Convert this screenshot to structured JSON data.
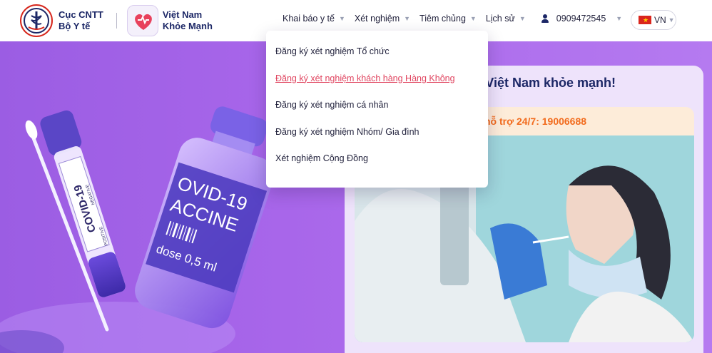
{
  "brand": {
    "moh_line1": "Cục CNTT",
    "moh_line2": "Bộ Y tế",
    "app_line1": "Việt Nam",
    "app_line2": "Khỏe Mạnh"
  },
  "nav": {
    "items": [
      {
        "label": "Khai báo y tế",
        "icon": "chevron-down-icon"
      },
      {
        "label": "Xét nghiệm",
        "icon": "chevron-down-icon"
      },
      {
        "label": "Tiêm chủng",
        "icon": "chevron-down-icon"
      },
      {
        "label": "Lịch sử",
        "icon": "chevron-down-icon"
      }
    ],
    "phone": "0909472545",
    "language": "VN"
  },
  "dropdown": {
    "items": [
      {
        "label": "Đăng ký xét nghiệm Tổ chức",
        "active": false
      },
      {
        "label": "Đăng ký xét nghiệm khách hàng Hàng Không",
        "active": true
      },
      {
        "label": "Đăng ký xét nghiệm cá nhân",
        "active": false
      },
      {
        "label": "Đăng ký xét nghiệm Nhóm/ Gia đình",
        "active": false
      },
      {
        "label": "Xét nghiệm Cộng Đồng",
        "active": false
      }
    ]
  },
  "hero": {
    "card_title": "Việt Nam khỏe mạnh!",
    "support_text": "hỗ trợ 24/7: 19006688",
    "test_tube_label": "COVID-19",
    "tube_small_text_1": "NEGATIVE",
    "tube_small_text_2": "POSITIVE",
    "vial_label_1": "OVID-19",
    "vial_label_2": "ACCINE",
    "vial_dose": "dose 0,5 ml"
  },
  "colors": {
    "hero_bg": "#a866ea",
    "accent_orange": "#f26b1d",
    "active_link": "#e0445f",
    "brand_navy": "#1c2766"
  }
}
